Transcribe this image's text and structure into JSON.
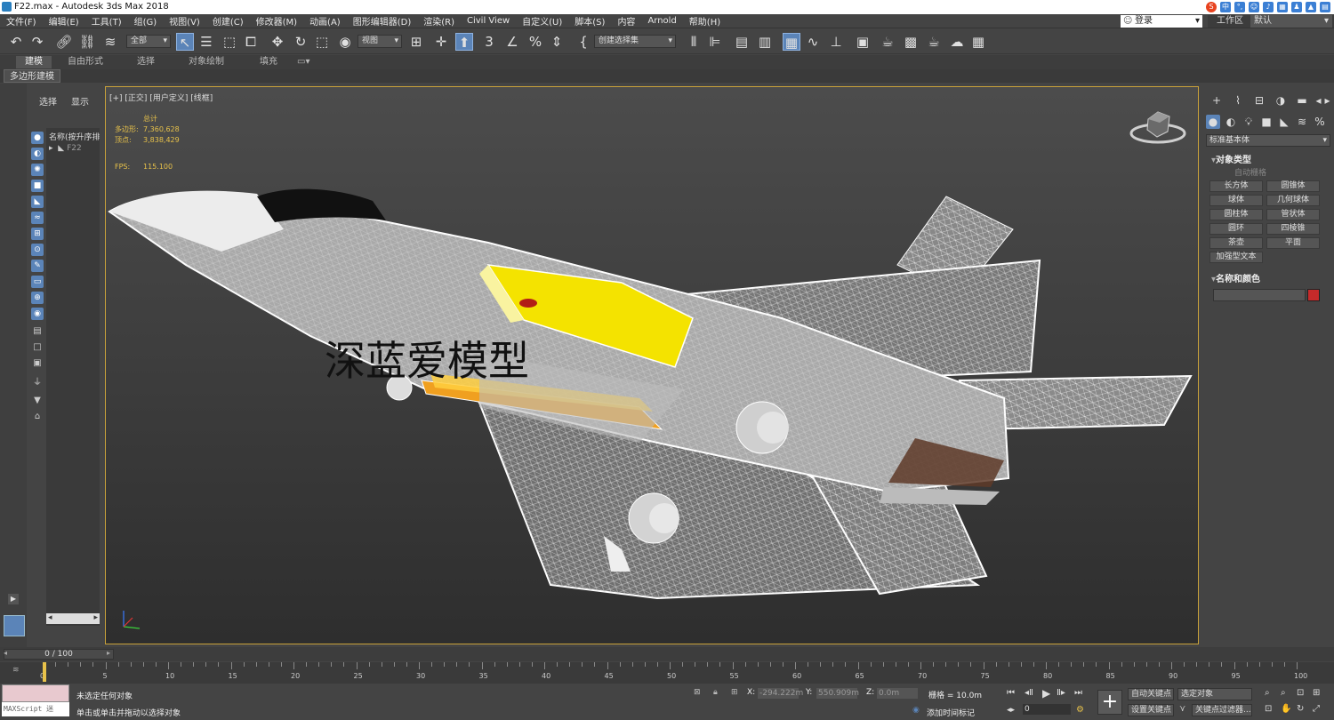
{
  "titlebar": {
    "title": "F22.max - Autodesk 3ds Max 2018"
  },
  "tray": {
    "icons": [
      "sogou-s-icon",
      "zh-input-icon",
      "punct-icon",
      "emoji-icon",
      "mic-icon",
      "keyboard-icon",
      "user-icon",
      "shirt-icon",
      "grid-icon"
    ],
    "zh_label": "中"
  },
  "menubar": {
    "items": [
      "文件(F)",
      "编辑(E)",
      "工具(T)",
      "组(G)",
      "视图(V)",
      "创建(C)",
      "修改器(M)",
      "动画(A)",
      "图形编辑器(D)",
      "渲染(R)",
      "Civil View",
      "自定义(U)",
      "脚本(S)",
      "内容",
      "Arnold",
      "帮助(H)"
    ]
  },
  "account": {
    "login_label": "登录",
    "workspace_label": "工作区",
    "workspace_value": "默认"
  },
  "toolbar": {
    "selection_filter": "全部",
    "ref_coord": "视图",
    "named_selection": "创建选择集"
  },
  "ribbon": {
    "tabs": [
      "建模",
      "自由形式",
      "选择",
      "对象绘制",
      "填充"
    ],
    "active_tab": "建模",
    "subtab": "多边形建模"
  },
  "scene_explorer": {
    "tab_select": "选择",
    "tab_display": "显示",
    "header": "名称(按升序排序)",
    "item": "F22"
  },
  "viewport": {
    "label": "[+] [正交] [用户定义] [线框]",
    "stats": {
      "total_label": "总计",
      "polys_label": "多边形:",
      "polys_value": "7,360,628",
      "verts_label": "顶点:",
      "verts_value": "3,838,429",
      "fps_label": "FPS:",
      "fps_value": "115.100"
    },
    "watermark": "深蓝爱模型",
    "border_color": "#c9a23a"
  },
  "command_panel": {
    "category_dropdown": "标准基本体",
    "rollout_object_type": "对象类型",
    "autogrid_label": "自动栅格",
    "buttons": [
      "长方体",
      "圆锥体",
      "球体",
      "几何球体",
      "圆柱体",
      "管状体",
      "圆环",
      "四棱锥",
      "茶壶",
      "平面",
      "加强型文本"
    ],
    "rollout_name_color": "名称和颜色",
    "object_color": "#c62a2a"
  },
  "timeline": {
    "frame_display": "0 / 100",
    "ticks": [
      "0",
      "5",
      "10",
      "15",
      "20",
      "25",
      "30",
      "35",
      "40",
      "45",
      "50",
      "55",
      "60",
      "65",
      "70",
      "75",
      "80",
      "85",
      "90",
      "95",
      "100"
    ]
  },
  "status": {
    "maxscript_label": "MAXScript 迷",
    "selection_status": "未选定任何对象",
    "prompt": "单击或单击并拖动以选择对象",
    "x_label": "X:",
    "x_value": "-294.222m",
    "y_label": "Y:",
    "y_value": "550.909m",
    "z_label": "Z:",
    "z_value": "0.0m",
    "grid_label": "栅格 = 10.0m",
    "add_time_tag": "添加时间标记",
    "auto_key": "自动关键点",
    "set_key": "设置关键点",
    "selected_object": "选定对象",
    "key_filters": "关键点过滤器...",
    "current_frame": "0"
  }
}
